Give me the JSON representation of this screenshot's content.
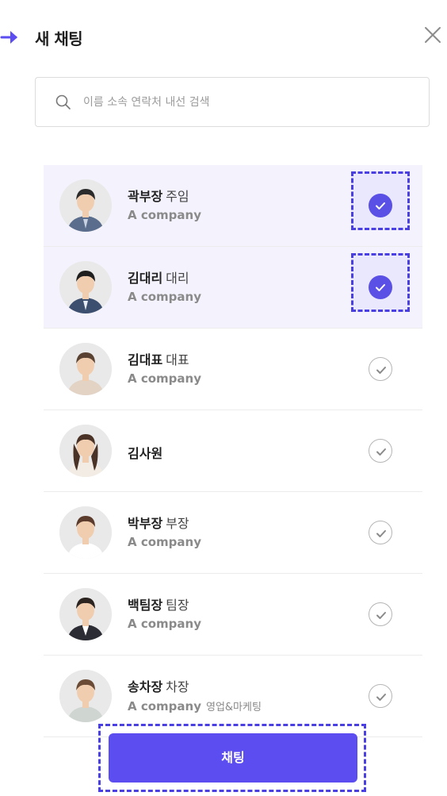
{
  "header": {
    "title": "새 채팅",
    "arrow_icon": "arrow-right-icon",
    "close_icon": "close-icon"
  },
  "search": {
    "placeholder": "이름 소속 연락처 내선 검색",
    "value": ""
  },
  "contacts": [
    {
      "name": "곽부장",
      "rank": "주임",
      "company": "A company",
      "dept": "",
      "selected": true,
      "avatar": "male-suit"
    },
    {
      "name": "김대리",
      "rank": "대리",
      "company": "A company",
      "dept": "",
      "selected": true,
      "avatar": "male-suit-young"
    },
    {
      "name": "김대표",
      "rank": "대표",
      "company": "A company",
      "dept": "",
      "selected": false,
      "avatar": "female-short"
    },
    {
      "name": "김사원",
      "rank": "",
      "company": "",
      "dept": "",
      "selected": false,
      "avatar": "female-long"
    },
    {
      "name": "박부장",
      "rank": "부장",
      "company": "A company",
      "dept": "",
      "selected": false,
      "avatar": "female-white"
    },
    {
      "name": "백팀장",
      "rank": "팀장",
      "company": "A company",
      "dept": "",
      "selected": false,
      "avatar": "female-dark-jacket"
    },
    {
      "name": "송차장",
      "rank": "차장",
      "company": "A company",
      "dept": "영업&마케팅",
      "selected": false,
      "avatar": "female-ponytail"
    }
  ],
  "actions": {
    "chat_label": "채팅"
  },
  "colors": {
    "accent": "#5b4df0",
    "selected_row": "#f4f2fd",
    "dashed_highlight": "#4a3fe0"
  }
}
